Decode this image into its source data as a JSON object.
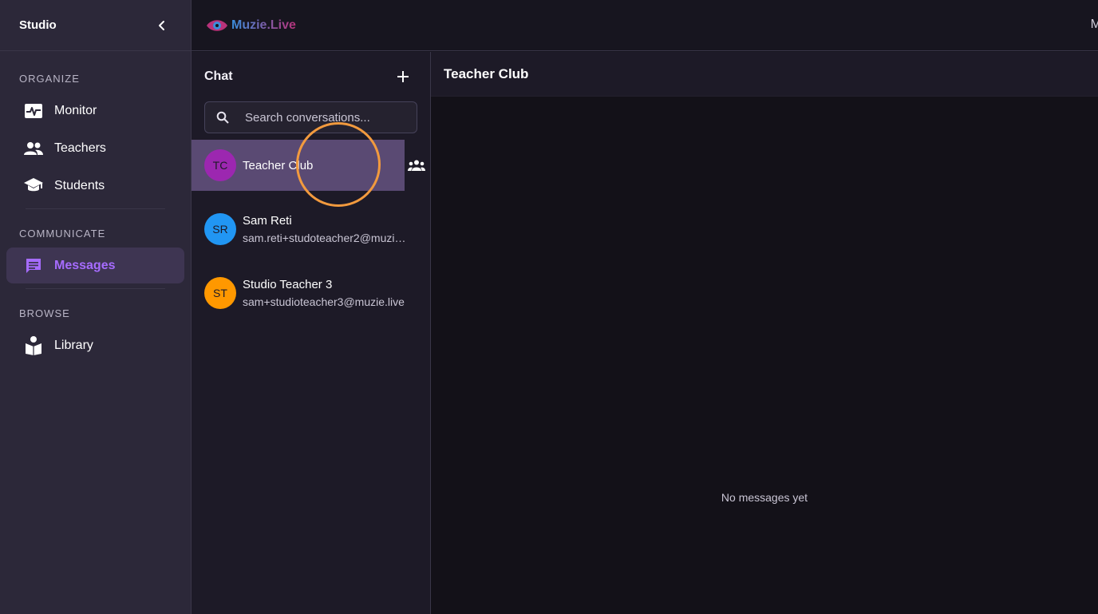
{
  "sidebar": {
    "title": "Studio",
    "sections": [
      {
        "label": "ORGANIZE",
        "items": [
          {
            "label": "Monitor",
            "icon": "monitor-heart-icon"
          },
          {
            "label": "Teachers",
            "icon": "people-icon"
          },
          {
            "label": "Students",
            "icon": "graduation-cap-icon"
          }
        ]
      },
      {
        "label": "COMMUNICATE",
        "items": [
          {
            "label": "Messages",
            "icon": "message-icon",
            "active": true
          }
        ]
      },
      {
        "label": "BROWSE",
        "items": [
          {
            "label": "Library",
            "icon": "book-reader-icon"
          }
        ]
      }
    ]
  },
  "topbar": {
    "logo_text": "Muzie.Live",
    "right_truncated": "M"
  },
  "chat": {
    "title": "Chat",
    "search_placeholder": "Search conversations...",
    "conversations": [
      {
        "initials": "TC",
        "name": "Teacher Club",
        "subtitle": "",
        "color": "#9c27b0",
        "active": true,
        "group": true
      },
      {
        "initials": "SR",
        "name": "Sam Reti",
        "subtitle": "sam.reti+studoteacher2@muzie.live",
        "color": "#2196f3"
      },
      {
        "initials": "ST",
        "name": "Studio Teacher 3",
        "subtitle": "sam+studioteacher3@muzie.live",
        "color": "#ff9800"
      }
    ]
  },
  "main": {
    "title": "Teacher Club",
    "empty_text": "No messages yet"
  },
  "colors": {
    "accent": "#a66cff",
    "active_conv": "#5a4a73"
  }
}
